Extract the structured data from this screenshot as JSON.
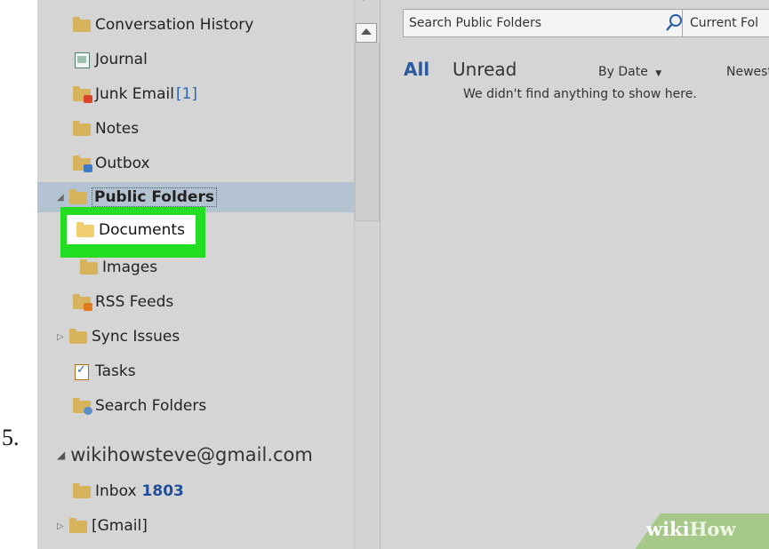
{
  "step_number": "5.",
  "folders": [
    {
      "label": "Conversation History",
      "icon": "folder-icon"
    },
    {
      "label": "Journal",
      "icon": "journal-icon"
    },
    {
      "label": "Junk Email",
      "count": "[1]",
      "icon": "junk-email-icon"
    },
    {
      "label": "Notes",
      "icon": "notes-folder-icon"
    },
    {
      "label": "Outbox",
      "icon": "outbox-icon"
    },
    {
      "label": "Public Folders",
      "icon": "folder-icon",
      "expanded": true,
      "selected": true
    },
    {
      "label": "Documents",
      "icon": "folder-icon",
      "highlighted": true
    },
    {
      "label": "Images",
      "icon": "folder-icon"
    },
    {
      "label": "RSS Feeds",
      "icon": "rss-folder-icon"
    },
    {
      "label": "Sync Issues",
      "icon": "folder-icon",
      "collapsed": true
    },
    {
      "label": "Tasks",
      "icon": "tasks-icon"
    },
    {
      "label": "Search Folders",
      "icon": "search-folder-icon"
    }
  ],
  "account": {
    "name": "wikihowsteve@gmail.com",
    "folders": [
      {
        "label": "Inbox",
        "count": "1803",
        "icon": "inbox-icon"
      },
      {
        "label": "[Gmail]",
        "icon": "folder-icon",
        "collapsed": true
      }
    ]
  },
  "search": {
    "placeholder": "Search Public Folders",
    "scope": "Current Fol"
  },
  "filters": {
    "all": "All",
    "unread": "Unread",
    "sort": "By Date",
    "order": "Newest"
  },
  "empty_message": "We didn't find anything to show here.",
  "watermark": {
    "part1": "wiki",
    "part2": "How"
  },
  "colors": {
    "highlight_box": "#22dd22",
    "selected_row": "#b4c3d1",
    "accent": "#2c5aa0"
  }
}
